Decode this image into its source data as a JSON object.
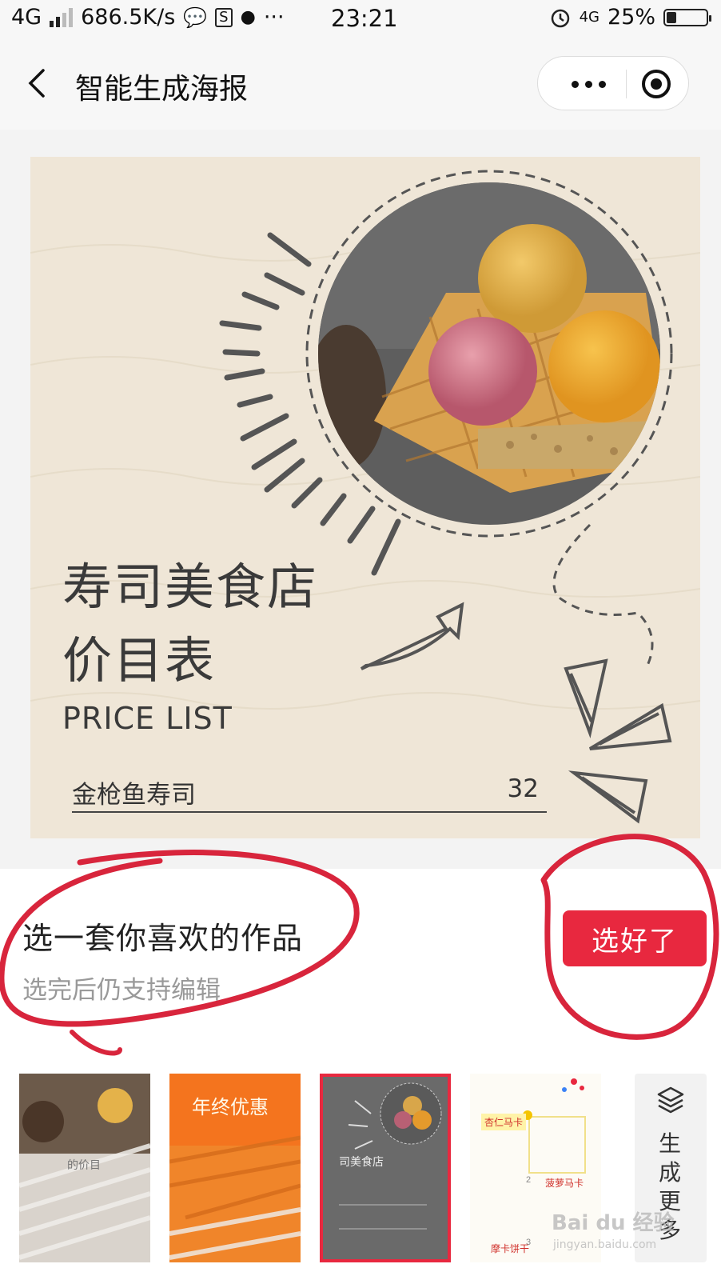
{
  "status_bar": {
    "network": "4G",
    "speed": "686.5K/s",
    "time": "23:21",
    "network_right": "4G",
    "battery_percent": "25%",
    "battery_level": 0.25,
    "icons": [
      "signal-icon",
      "wechat-icon",
      "app-s-icon",
      "qq-icon",
      "ellipsis-icon",
      "alarm-icon",
      "battery-icon"
    ]
  },
  "nav": {
    "title": "智能生成海报",
    "back_icon": "chevron-left-icon",
    "more_icon": "more-dots-icon",
    "close_icon": "target-circle-icon"
  },
  "poster": {
    "title_line1": "寿司美食店",
    "title_line2": "价目表",
    "subtitle": "PRICE LIST",
    "item_name": "金枪鱼寿司",
    "item_price": "32"
  },
  "panel": {
    "heading": "选一套你喜欢的作品",
    "subtext": "选完后仍支持编辑",
    "confirm_button": "选好了"
  },
  "thumbnails": [
    {
      "label": "的价目"
    },
    {
      "label": "年终优惠"
    },
    {
      "label": "司美食店"
    },
    {
      "labels": [
        "杏仁马卡",
        "菠萝马卡",
        "摩卡饼干"
      ]
    }
  ],
  "more_tab": {
    "label": "生成更多",
    "icon": "layers-icon"
  },
  "watermark": {
    "text": "Bai du 经验",
    "url": "jingyan.baidu.com"
  },
  "colors": {
    "accent": "#e8283f",
    "poster_bg": "#efe6d7",
    "annotation": "#d8253c"
  }
}
